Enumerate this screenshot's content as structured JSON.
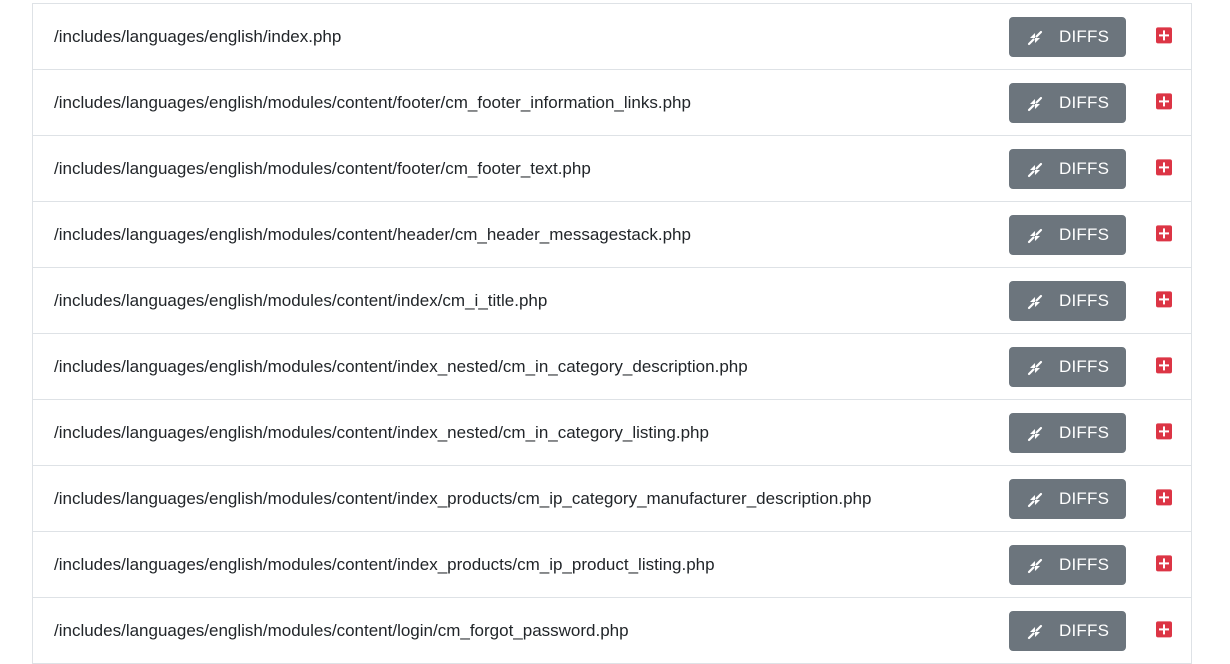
{
  "files": [
    {
      "path": "/includes/languages/english/index.php",
      "diffs_label": "DIFFS"
    },
    {
      "path": "/includes/languages/english/modules/content/footer/cm_footer_information_links.php",
      "diffs_label": "DIFFS"
    },
    {
      "path": "/includes/languages/english/modules/content/footer/cm_footer_text.php",
      "diffs_label": "DIFFS"
    },
    {
      "path": "/includes/languages/english/modules/content/header/cm_header_messagestack.php",
      "diffs_label": "DIFFS"
    },
    {
      "path": "/includes/languages/english/modules/content/index/cm_i_title.php",
      "diffs_label": "DIFFS"
    },
    {
      "path": "/includes/languages/english/modules/content/index_nested/cm_in_category_description.php",
      "diffs_label": "DIFFS"
    },
    {
      "path": "/includes/languages/english/modules/content/index_nested/cm_in_category_listing.php",
      "diffs_label": "DIFFS"
    },
    {
      "path": "/includes/languages/english/modules/content/index_products/cm_ip_category_manufacturer_description.php",
      "diffs_label": "DIFFS"
    },
    {
      "path": "/includes/languages/english/modules/content/index_products/cm_ip_product_listing.php",
      "diffs_label": "DIFFS"
    },
    {
      "path": "/includes/languages/english/modules/content/login/cm_forgot_password.php",
      "diffs_label": "DIFFS"
    }
  ],
  "icons": {
    "diffs_button": "compress-arrows-icon",
    "expand": "plus-square-icon"
  },
  "colors": {
    "button_bg": "#6c757d",
    "plus_icon": "#dc3545",
    "row_border": "#dee2e6",
    "text": "#212529"
  }
}
